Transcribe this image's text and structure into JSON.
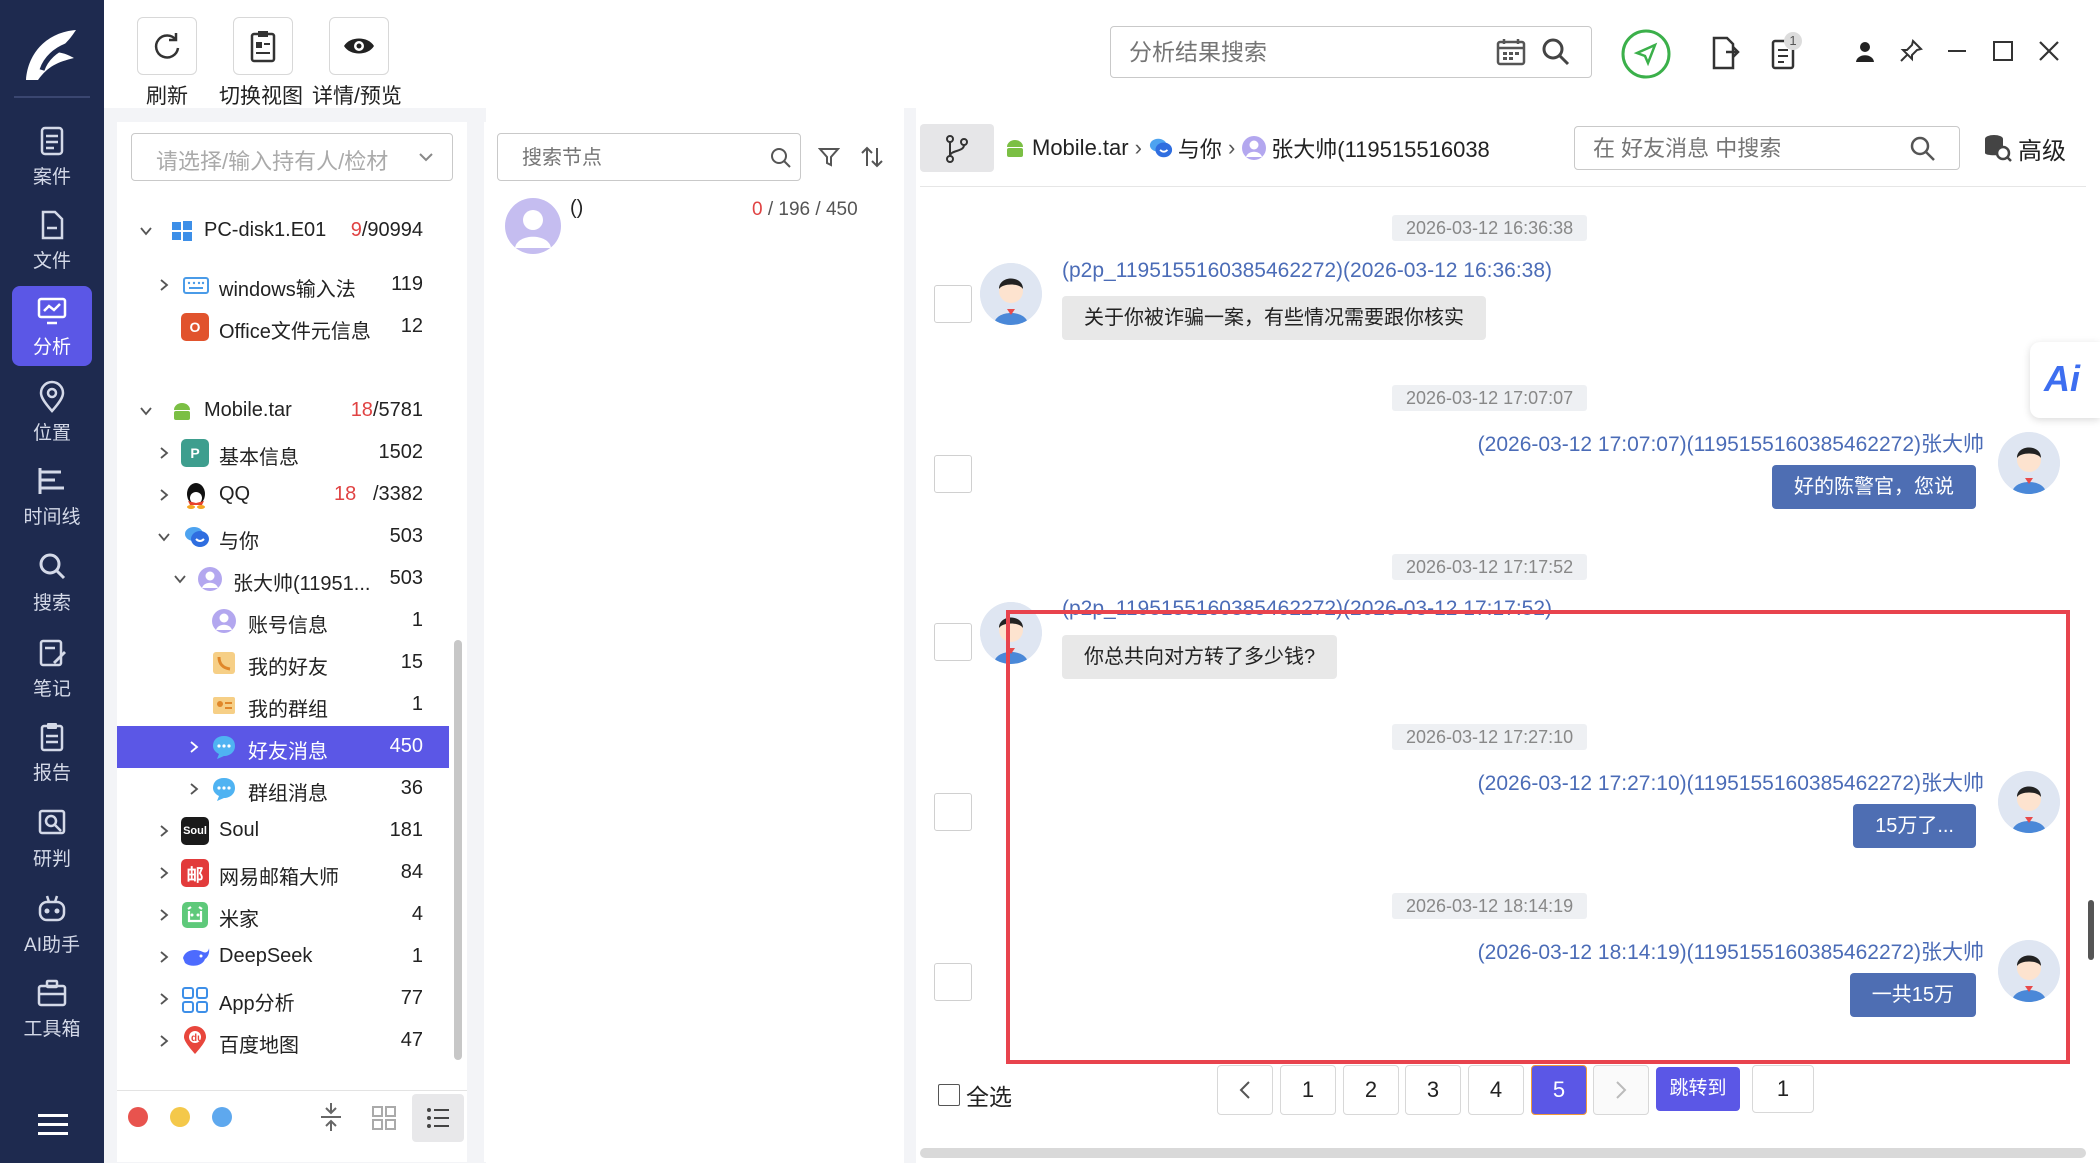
{
  "toolbar": {
    "refresh_label": "刷新",
    "switch_view_label": "切换视图",
    "details_label": "详情/预览"
  },
  "top_search": {
    "placeholder": "分析结果搜索"
  },
  "notification_badge": "1",
  "nav": {
    "items": [
      {
        "label": "案件",
        "icon": "case-icon"
      },
      {
        "label": "文件",
        "icon": "file-icon"
      },
      {
        "label": "分析",
        "icon": "analysis-icon",
        "active": true
      },
      {
        "label": "位置",
        "icon": "location-icon"
      },
      {
        "label": "时间线",
        "icon": "timeline-icon"
      },
      {
        "label": "搜索",
        "icon": "search-icon"
      },
      {
        "label": "笔记",
        "icon": "note-icon"
      },
      {
        "label": "报告",
        "icon": "report-icon"
      },
      {
        "label": "研判",
        "icon": "judge-icon"
      },
      {
        "label": "AI助手",
        "icon": "ai-robot-icon"
      },
      {
        "label": "工具箱",
        "icon": "toolbox-icon"
      }
    ]
  },
  "tree": {
    "holder_placeholder": "请选择/输入持有人/检材",
    "items": [
      {
        "label": "PC-disk1.E01",
        "count_red": "9",
        "count": "/90994"
      },
      {
        "label": "windows输入法",
        "count": "119"
      },
      {
        "label": "Office文件元信息",
        "count": "12"
      },
      {
        "label": "Mobile.tar",
        "count_red": "18",
        "count": "/5781"
      },
      {
        "label": "基本信息",
        "count": "1502"
      },
      {
        "label": "QQ",
        "count_red": "18",
        "count": "/3382"
      },
      {
        "label": "与你",
        "count": "503"
      },
      {
        "label": "张大帅(11951...",
        "count": "503"
      },
      {
        "label": "账号信息",
        "count": "1"
      },
      {
        "label": "我的好友",
        "count": "15"
      },
      {
        "label": "我的群组",
        "count": "1"
      },
      {
        "label": "好友消息",
        "count": "450"
      },
      {
        "label": "群组消息",
        "count": "36"
      },
      {
        "label": "Soul",
        "count": "181"
      },
      {
        "label": "网易邮箱大师",
        "count": "84"
      },
      {
        "label": "米家",
        "count": "4"
      },
      {
        "label": "DeepSeek",
        "count": "1"
      },
      {
        "label": "App分析",
        "count": "77"
      },
      {
        "label": "百度地图",
        "count": "47"
      }
    ],
    "soul_icon_text": "Soul",
    "mail_icon_text": "邮",
    "baidu_icon_text": "du",
    "status_colors": [
      "#e8534e",
      "#f4c84a",
      "#5ea8ee"
    ]
  },
  "node_panel": {
    "search_placeholder": "搜索节点",
    "node_name": "()",
    "count_red": "0",
    "count_rest": "/ 196 / 450"
  },
  "chat": {
    "breadcrumb": [
      "Mobile.tar",
      "与你",
      "张大帅(119515516038"
    ],
    "search_placeholder": "在 好友消息 中搜索",
    "advanced_label": "高级",
    "ai_label": "Ai",
    "messages": [
      {
        "time": "2026-03-12 16:36:38",
        "sender": "(p2p_1195155160385462272)(2026-03-12 16:36:38)",
        "text": "关于你被诈骗一案，有些情况需要跟你核实",
        "side": "left"
      },
      {
        "time": "2026-03-12 17:07:07",
        "sender": "(2026-03-12 17:07:07)(1195155160385462272)张大帅",
        "text": "好的陈警官，您说",
        "side": "right"
      },
      {
        "time": "2026-03-12 17:17:52",
        "sender": "(p2p_1195155160385462272)(2026-03-12 17:17:52)",
        "text": "你总共向对方转了多少钱?",
        "side": "left"
      },
      {
        "time": "2026-03-12 17:27:10",
        "sender": "(2026-03-12 17:27:10)(1195155160385462272)张大帅",
        "text": "15万了...",
        "side": "right"
      },
      {
        "time": "2026-03-12 18:14:19",
        "sender": "(2026-03-12 18:14:19)(1195155160385462272)张大帅",
        "text": "一共15万",
        "side": "right"
      }
    ],
    "select_all_label": "全选",
    "pages": [
      "1",
      "2",
      "3",
      "4",
      "5"
    ],
    "current_page": "5",
    "jump_label": "跳转到",
    "jump_value": "1"
  },
  "colors": {
    "nav_bg": "#1e2a4f",
    "accent": "#5b57e6",
    "bubble_right": "#4e6eb3",
    "highlight_border": "#e8434d",
    "pin_green": "#3bb04a"
  }
}
